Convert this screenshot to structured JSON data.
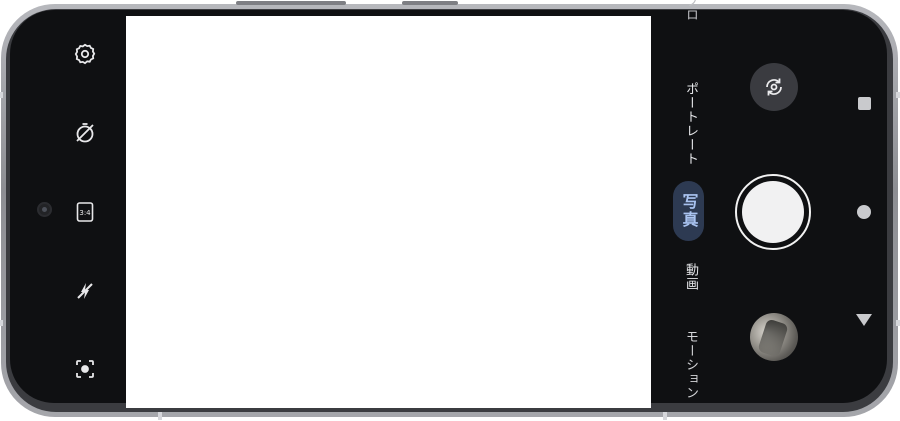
{
  "toolbar": {
    "icons": [
      "settings-icon",
      "timer-off-icon",
      "aspect-ratio-icon",
      "flash-off-icon",
      "lens-icon"
    ],
    "aspect_label": "3:4"
  },
  "modes": {
    "top_partial": "プロ",
    "portrait": "ポートレート",
    "photo": "写真",
    "video": "動画",
    "motion_partial": "モーション"
  },
  "controls": {
    "flip_icon": "flip-camera-icon",
    "shutter_icon": "shutter-button",
    "thumbnail": "last-photo-thumbnail"
  },
  "nav": {
    "recent": "recent-apps-icon",
    "home": "home-icon",
    "back": "back-icon"
  },
  "colors": {
    "screen_bg": "#0f1012",
    "selected_mode_bg": "#2d3a52",
    "selected_mode_text": "#a9c3f0"
  }
}
